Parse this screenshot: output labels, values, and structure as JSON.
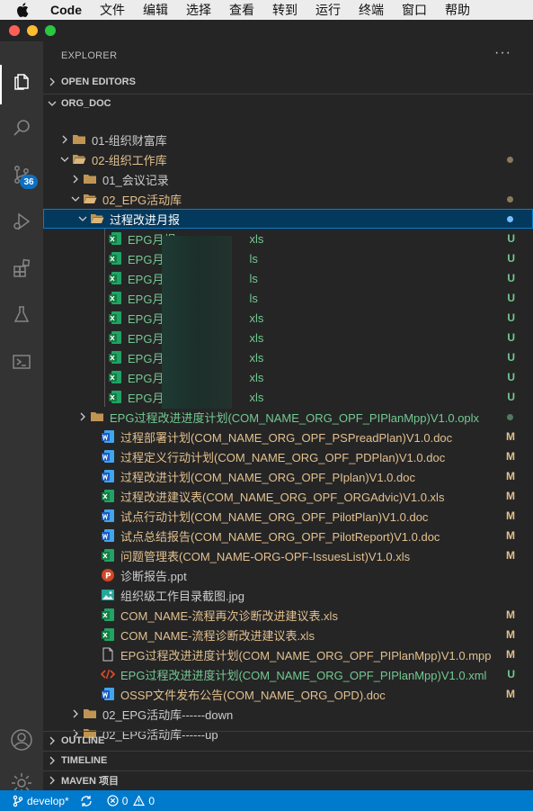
{
  "menubar": {
    "app": "Code",
    "items": [
      "文件",
      "编辑",
      "选择",
      "查看",
      "转到",
      "运行",
      "终端",
      "窗口",
      "帮助"
    ]
  },
  "activity": {
    "scm_badge": "36"
  },
  "explorer": {
    "title": "EXPLORER",
    "more": "···",
    "open_editors": "OPEN EDITORS",
    "root": "ORG_DOC",
    "tree": [
      {
        "label": "01-组织财富库",
        "kind": "folder",
        "status": "default"
      },
      {
        "label": "02-组织工作库",
        "kind": "folder-open",
        "status": "mod",
        "dot": "#8a7a5c"
      },
      {
        "label": "01_会议记录",
        "kind": "folder",
        "status": "default"
      },
      {
        "label": "02_EPG活动库",
        "kind": "folder-open",
        "status": "mod",
        "dot": "#8a7a5c"
      },
      {
        "label": "过程改进月报",
        "kind": "folder-open",
        "status": "selected",
        "dot": "#75beff"
      },
      {
        "label": "EPG月报",
        "suffix": "xls",
        "kind": "xls",
        "status": "untracked",
        "deco": "U"
      },
      {
        "label": "EPG月报",
        "suffix": "ls",
        "kind": "xls",
        "status": "untracked",
        "deco": "U"
      },
      {
        "label": "EPG月报",
        "suffix": "ls",
        "kind": "xls",
        "status": "untracked",
        "deco": "U"
      },
      {
        "label": "EPG月报",
        "suffix": "ls",
        "kind": "xls",
        "status": "untracked",
        "deco": "U"
      },
      {
        "label": "EPG月报",
        "suffix": "xls",
        "kind": "xls",
        "status": "untracked",
        "deco": "U"
      },
      {
        "label": "EPG月报",
        "suffix": "xls",
        "kind": "xls",
        "status": "untracked",
        "deco": "U"
      },
      {
        "label": "EPG月报",
        "suffix": "xls",
        "kind": "xls",
        "status": "untracked",
        "deco": "U"
      },
      {
        "label": "EPG月报",
        "suffix": "xls",
        "kind": "xls",
        "status": "untracked",
        "deco": "U"
      },
      {
        "label": "EPG月报",
        "suffix": "xls",
        "kind": "xls",
        "status": "untracked",
        "deco": "U"
      },
      {
        "label": "EPG过程改进进度计划(COM_NAME_ORG_OPF_PIPlanMpp)V1.0.oplx",
        "kind": "folder",
        "status": "untracked",
        "dot": "#4f7a5e"
      },
      {
        "label": "过程部署计划(COM_NAME_ORG_OPF_PSPreadPlan)V1.0.doc",
        "kind": "doc",
        "status": "mod",
        "deco": "M"
      },
      {
        "label": "过程定义行动计划(COM_NAME_ORG_OPF_PDPlan)V1.0.doc",
        "kind": "doc",
        "status": "mod",
        "deco": "M"
      },
      {
        "label": "过程改进计划(COM_NAME_ORG_OPF_PIplan)V1.0.doc",
        "kind": "doc",
        "status": "mod",
        "deco": "M"
      },
      {
        "label": "过程改进建议表(COM_NAME_ORG_OPF_ORGAdvic)V1.0.xls",
        "kind": "xls",
        "status": "mod",
        "deco": "M"
      },
      {
        "label": "试点行动计划(COM_NAME_ORG_OPF_PilotPlan)V1.0.doc",
        "kind": "doc",
        "status": "mod",
        "deco": "M"
      },
      {
        "label": "试点总结报告(COM_NAME_ORG_OPF_PilotReport)V1.0.doc",
        "kind": "doc",
        "status": "mod",
        "deco": "M"
      },
      {
        "label": "问题管理表(COM_NAME-ORG-OPF-IssuesList)V1.0.xls",
        "kind": "xls",
        "status": "mod",
        "deco": "M"
      },
      {
        "label": "诊断报告.ppt",
        "kind": "ppt",
        "status": "default"
      },
      {
        "label": "组织级工作目录截图.jpg",
        "kind": "img",
        "status": "default"
      },
      {
        "label": "COM_NAME-流程再次诊断改进建议表.xls",
        "kind": "xls",
        "status": "mod",
        "deco": "M"
      },
      {
        "label": "COM_NAME-流程诊断改进建议表.xls",
        "kind": "xls",
        "status": "mod",
        "deco": "M"
      },
      {
        "label": "EPG过程改进进度计划(COM_NAME_ORG_OPF_PIPlanMpp)V1.0.mpp",
        "kind": "file",
        "status": "mod",
        "deco": "M"
      },
      {
        "label": "EPG过程改进进度计划(COM_NAME_ORG_OPF_PIPlanMpp)V1.0.xml",
        "kind": "xml",
        "status": "untracked",
        "deco": "U"
      },
      {
        "label": "OSSP文件发布公告(COM_NAME_ORG_OPD).doc",
        "kind": "doc",
        "status": "mod",
        "deco": "M"
      },
      {
        "label": "02_EPG活动库------down",
        "kind": "folder",
        "status": "default"
      },
      {
        "label": "02_EPG活动库------up",
        "kind": "folder",
        "status": "default"
      }
    ],
    "outline": "OUTLINE",
    "timeline": "TIMELINE",
    "maven": "MAVEN 项目"
  },
  "statusbar": {
    "branch": "develop*",
    "errors": "0",
    "warnings": "0"
  },
  "colors": {
    "accent": "#007acc",
    "modified": "#e2c08d",
    "untracked": "#73c991"
  }
}
